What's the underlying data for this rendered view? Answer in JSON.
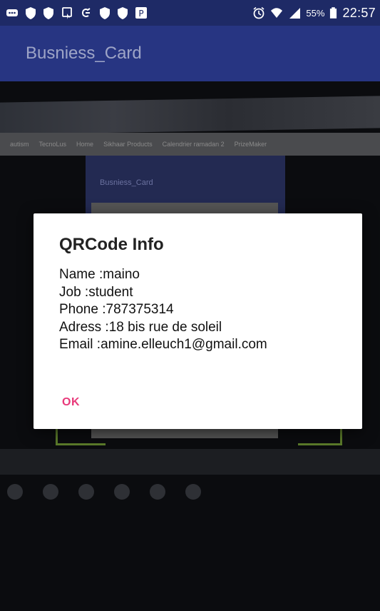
{
  "status_bar": {
    "battery_percent": "55%",
    "time": "22:57",
    "icons": [
      "more-icon",
      "shield-icon",
      "shield-icon",
      "cast-icon",
      "usb-icon",
      "shield-icon",
      "shield-icon",
      "p-icon",
      "alarm-icon",
      "wifi-icon",
      "signal-icon",
      "battery-icon"
    ]
  },
  "app_bar": {
    "title": "Busniess_Card"
  },
  "camera_preview": {
    "inner_title": "Busniess_Card",
    "browser_bookmarks": [
      "autism",
      "TecnoLus",
      "Home",
      "Sikhaar Products",
      "Calendrier ramadan 2",
      "PrizeMaker"
    ]
  },
  "dialog": {
    "title": "QRCode Info",
    "lines": [
      "Name :maino",
      "Job :student",
      "Phone :787375314",
      "Adress :18 bis rue de soleil",
      "Email :amine.elleuch1@gmail.com"
    ],
    "ok_label": "OK",
    "ok_color": "#e8397a"
  }
}
